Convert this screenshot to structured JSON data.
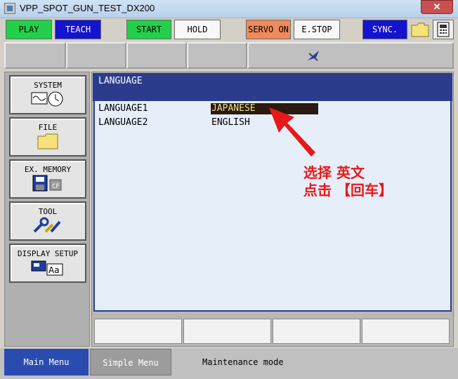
{
  "window": {
    "title": "VPP_SPOT_GUN_TEST_DX200",
    "close_label": "✕"
  },
  "toolbar": {
    "play": "PLAY",
    "teach": "TEACH",
    "start": "START",
    "hold": "HOLD",
    "servo_on": "SERVO ON",
    "estop": "E.STOP",
    "sync": "SYNC."
  },
  "colors": {
    "green": "#22d04a",
    "blue": "#1414d0",
    "orange": "#f08a5a",
    "header": "#2c3c8c"
  },
  "main_menu": {
    "system": "SYSTEM",
    "file": "FILE",
    "ex_memory": "EX. MEMORY",
    "tool": "TOOL",
    "display_setup": "DISPLAY SETUP"
  },
  "screen": {
    "title": "LANGUAGE",
    "rows": [
      {
        "label": "LANGUAGE1",
        "value": "JAPANESE"
      },
      {
        "label": "LANGUAGE2",
        "value": "ENGLISH"
      }
    ]
  },
  "annotation": {
    "line1": "选择 英文",
    "line2": "点击 【回车】"
  },
  "bottom": {
    "main_menu": "Main Menu",
    "simple_menu": "Simple Menu",
    "status": "Maintenance mode"
  }
}
